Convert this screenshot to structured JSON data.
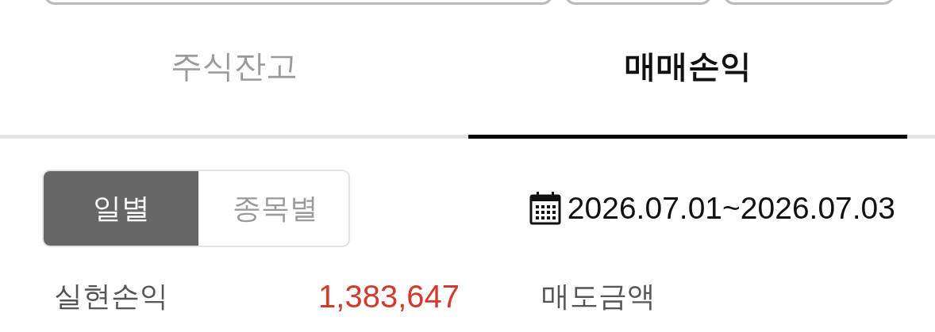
{
  "top_controls": [
    {
      "kind": "box"
    },
    {
      "kind": "box"
    },
    {
      "kind": "box"
    }
  ],
  "tabs": [
    {
      "label": "주식잔고",
      "selected": false
    },
    {
      "label": "매매손익",
      "selected": true
    }
  ],
  "view_toggle": [
    {
      "label": "일별",
      "selected": true
    },
    {
      "label": "종목별",
      "selected": false
    }
  ],
  "date_range": "2026.07.01~2026.07.03",
  "summary": [
    {
      "label": "실현손익",
      "value": "1,383,647"
    },
    {
      "label": "매도금액"
    }
  ]
}
